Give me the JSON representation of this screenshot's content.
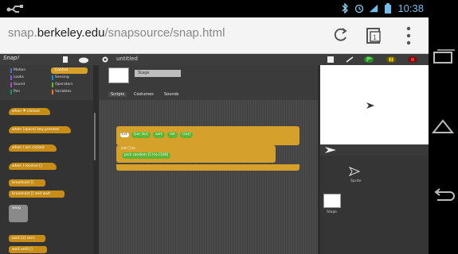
{
  "status_bar": {
    "time": "10:38",
    "icons": [
      "usb-icon",
      "bluetooth-icon",
      "alarm-icon",
      "signal-4g-icon",
      "battery-icon"
    ]
  },
  "browser": {
    "url_prefix": "snap.",
    "url_domain": "berkeley.edu",
    "url_path": "/snapsource/snap.html"
  },
  "snap": {
    "logo": "Snap!",
    "project_title": "untitled",
    "categories": [
      {
        "label": "Motion",
        "color": "#4a6cd4"
      },
      {
        "label": "Looks",
        "color": "#8a55d7"
      },
      {
        "label": "Sound",
        "color": "#bb42c3"
      },
      {
        "label": "Pen",
        "color": "#0e9a6c"
      },
      {
        "label": "Control",
        "color": "#e6a822",
        "selected": true
      },
      {
        "label": "Sensing",
        "color": "#0494dc"
      },
      {
        "label": "Operators",
        "color": "#62c213"
      },
      {
        "label": "Variables",
        "color": "#f3761d"
      }
    ],
    "palette_blocks": [
      "when ⚑ clicked",
      "when [space] key pressed",
      "when I am clicked",
      "when I receive []",
      "broadcast []",
      "broadcast [] and wait",
      "warp",
      "wait [1] secs",
      "wait until []"
    ],
    "sprite_name": "Stage",
    "tabs": [
      "Scripts",
      "Costumes",
      "Sounds"
    ],
    "script": {
      "line1_var": "list",
      "line1_items": [
        "[(a) (b)]",
        "sort",
        "list",
        "[(a)]"
      ],
      "line2": "set [] to",
      "line3": "pick random [1] to [100]"
    },
    "corral": {
      "sprite_label": "Sprite",
      "stage_label": "Stage"
    }
  },
  "colors": {
    "control": "#d6a12a",
    "operators": "#5bb537",
    "url_domain": "#222222",
    "status_accent": "#6fbfef"
  }
}
